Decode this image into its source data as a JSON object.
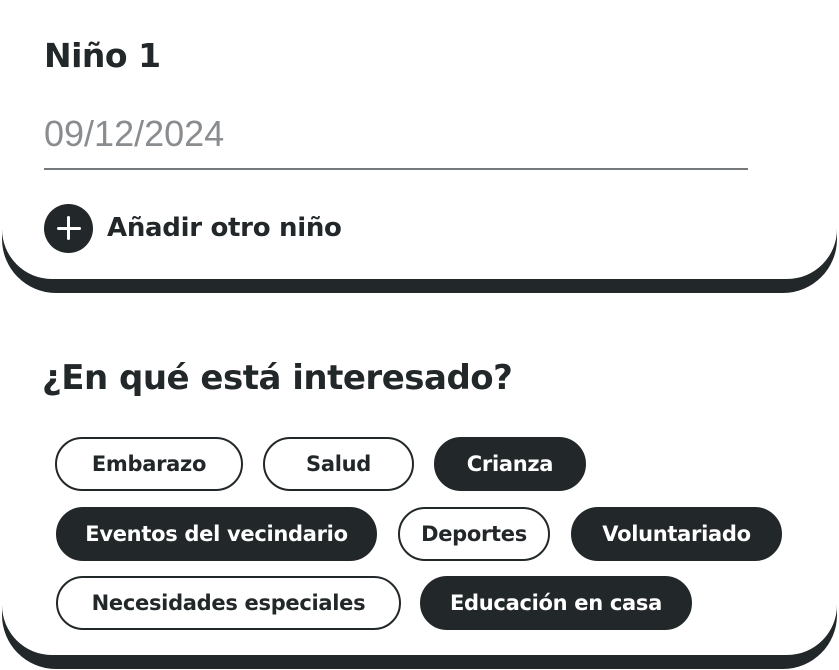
{
  "child": {
    "title": "Niño 1",
    "date_value": "09/12/2024",
    "add_label": "Añadir otro niño"
  },
  "interests": {
    "title": "¿En qué está interesado?",
    "chips": [
      {
        "label": "Embarazo",
        "selected": false
      },
      {
        "label": "Salud",
        "selected": false
      },
      {
        "label": "Crianza",
        "selected": true
      },
      {
        "label": "Eventos del vecindario",
        "selected": true
      },
      {
        "label": "Deportes",
        "selected": false
      },
      {
        "label": "Voluntariado",
        "selected": true
      },
      {
        "label": "Necesidades especiales",
        "selected": false
      },
      {
        "label": "Educación en casa",
        "selected": true
      }
    ]
  },
  "colors": {
    "dark": "#222729",
    "muted_text": "#8a8d90",
    "underline": "#76797c",
    "background": "#ffffff"
  },
  "icons": {
    "add": "plus-circle-icon"
  }
}
